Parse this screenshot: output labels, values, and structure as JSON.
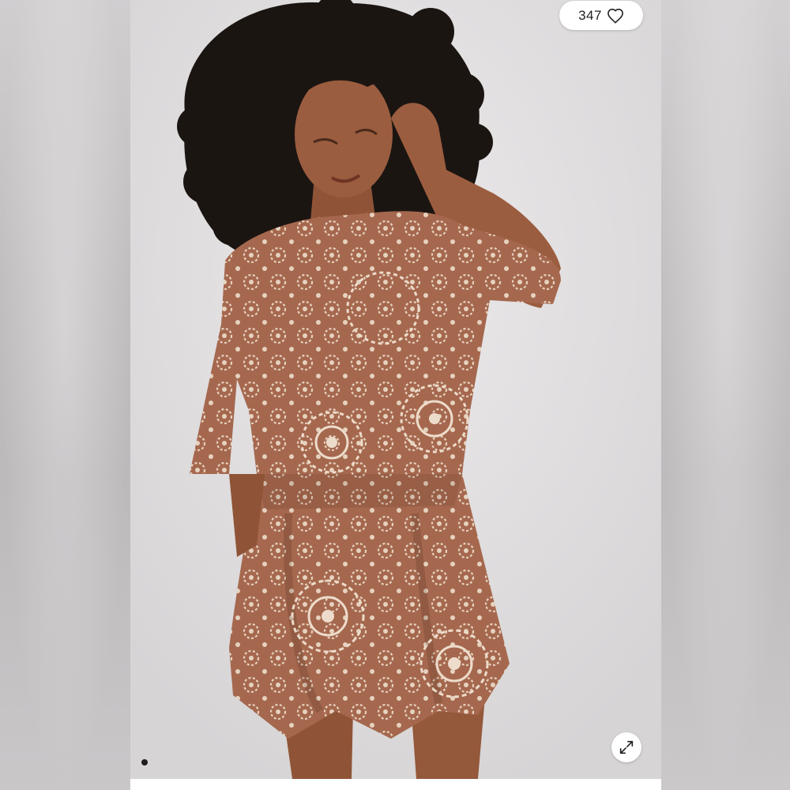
{
  "listing": {
    "likes_count": "347",
    "like_icon": "heart-outline-icon",
    "expand_icon": "expand-arrows-icon",
    "image_index": 1
  },
  "colors": {
    "dress": "#a5684e",
    "pattern": "#e6d2bf",
    "skin": "#9b5d3f",
    "hair": "#1b1512",
    "background": "#e0dedf"
  }
}
